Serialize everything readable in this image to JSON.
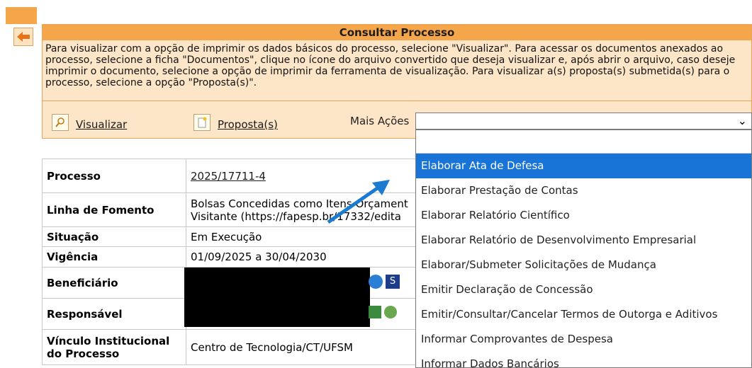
{
  "panel": {
    "title": "Consultar Processo",
    "description": "Para visualizar com a opção de imprimir os dados básicos do processo, selecione \"Visualizar\". Para acessar os documentos anexados ao processo, selecione a ficha \"Documentos\", clique no ícone do arquivo convertido que deseja visualizar e, após abrir o arquivo, caso deseje imprimir o documento, selecione a opção de imprimir da ferramenta de visualização. Para visualizar a(s) proposta(s) submetida(s) para o processo, selecione a opção \"Proposta(s)\"."
  },
  "actions": {
    "visualizar": "Visualizar",
    "propostas": "Proposta(s)",
    "mais_acoes_label": "Mais Ações",
    "select_value": ""
  },
  "dropdown": {
    "items": [
      "Elaborar Ata de Defesa",
      "Elaborar Prestação de Contas",
      "Elaborar Relatório Científico",
      "Elaborar Relatório de Desenvolvimento Empresarial",
      "Elaborar/Submeter Solicitações de Mudança",
      "Emitir Declaração de Concessão",
      "Emitir/Consultar/Cancelar Termos de Outorga e Aditivos",
      "Informar Comprovantes de Despesa",
      "Informar Dados Bancários"
    ],
    "selected_index": 0
  },
  "table": {
    "rows": [
      {
        "label": "Processo",
        "value": "2025/17711-4"
      },
      {
        "label": "Linha de Fomento",
        "value": "Bolsas Concedidas como Itens Orçament",
        "value2": "Visitante (https://fapesp.br/17332/edita"
      },
      {
        "label": "Situação",
        "value": "Em Execução"
      },
      {
        "label": "Vigência",
        "value": "01/09/2025 a 30/04/2030"
      },
      {
        "label": "Beneficiário",
        "value": ""
      },
      {
        "label": "Responsável",
        "value": ""
      },
      {
        "label": "Vínculo Institucional do Processo",
        "value": "Centro de Tecnologia/CT/UFSM"
      }
    ]
  },
  "colors": {
    "header_orange": "#f5a64a",
    "panel_bg": "#fde6c8",
    "selected_blue": "#1874d6",
    "arrow_blue": "#1a7bd0"
  }
}
